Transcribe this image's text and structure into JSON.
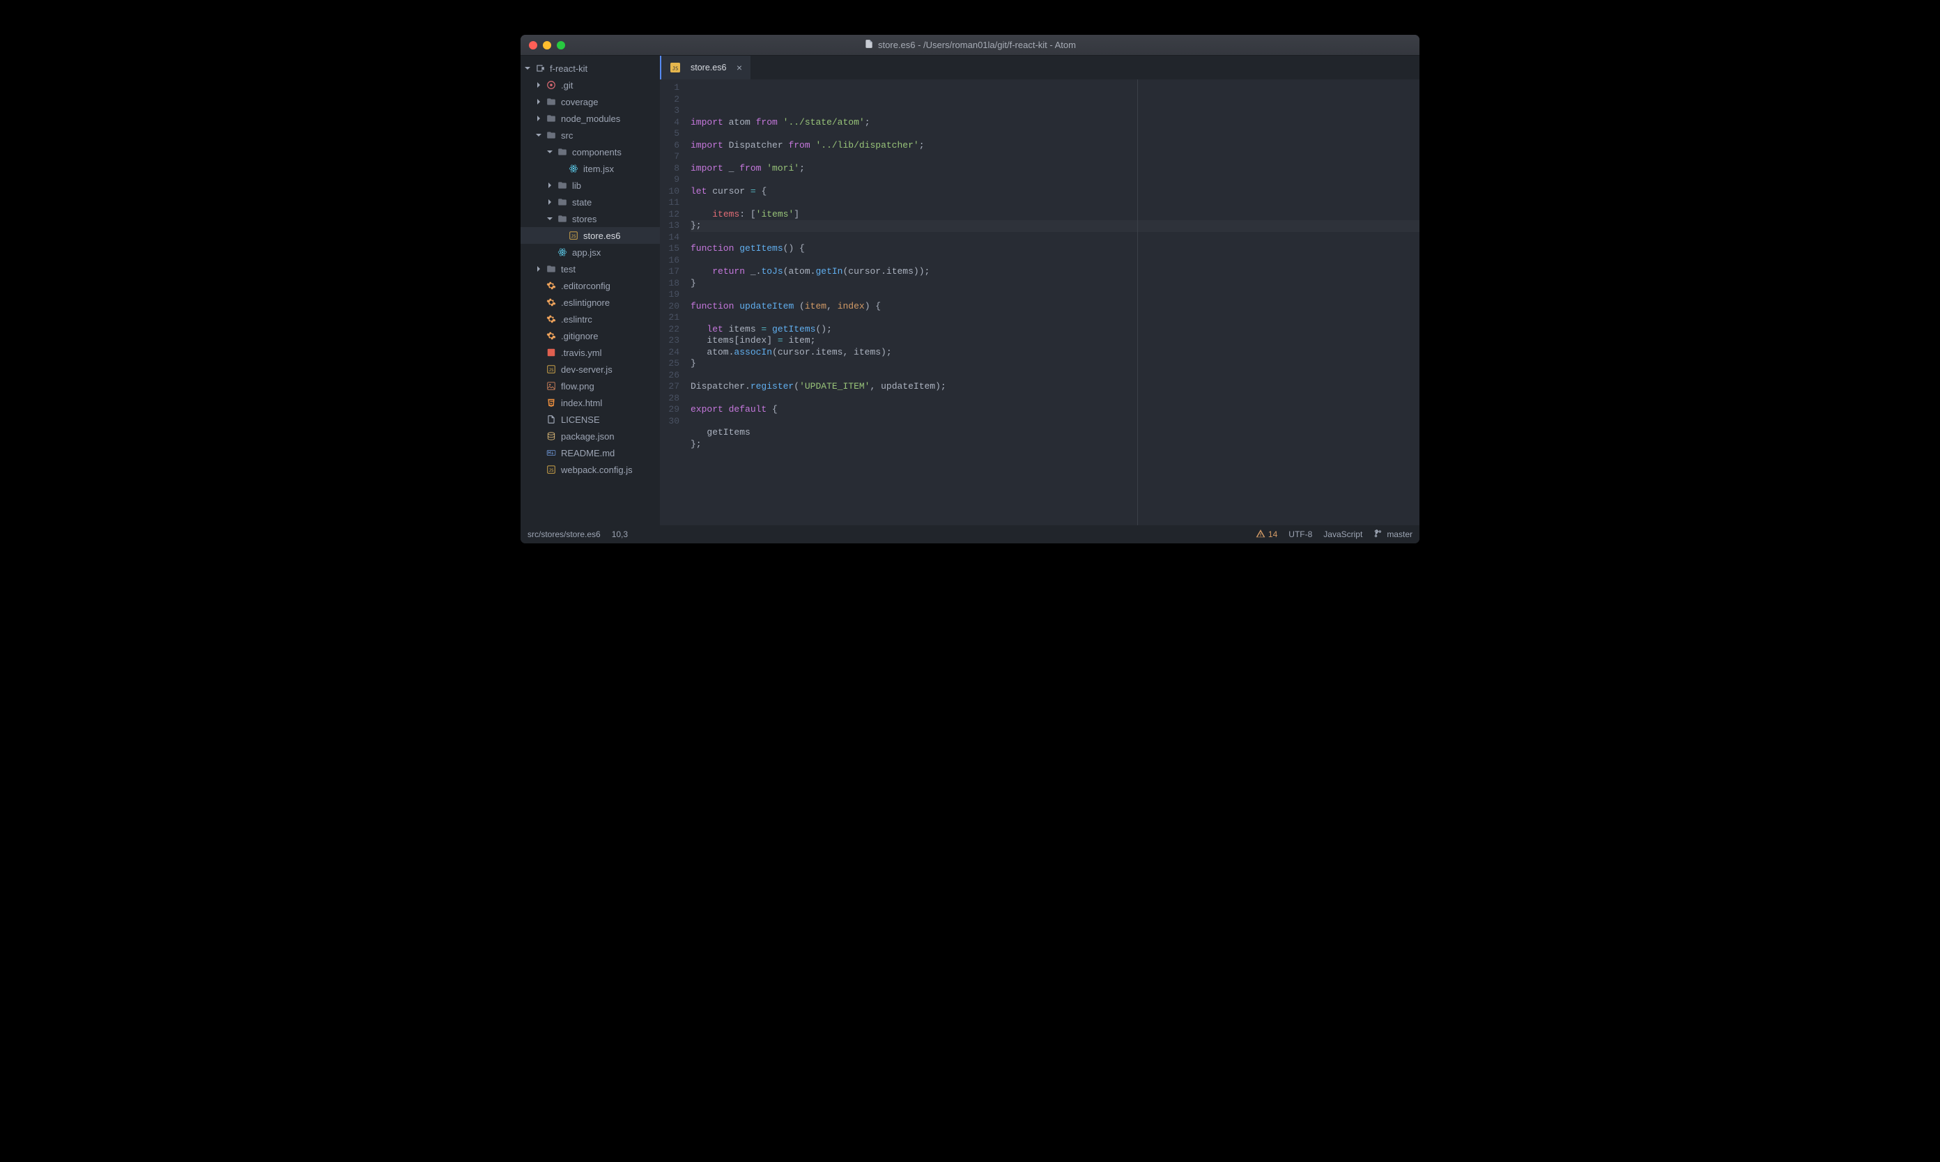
{
  "window": {
    "title": "store.es6 - /Users/roman01la/git/f-react-kit - Atom"
  },
  "sidebar": {
    "project": "f-react-kit",
    "items": [
      {
        "depth": 1,
        "icon": "git",
        "label": ".git",
        "chev": "closed"
      },
      {
        "depth": 1,
        "icon": "folder",
        "label": "coverage",
        "chev": "closed"
      },
      {
        "depth": 1,
        "icon": "folder",
        "label": "node_modules",
        "chev": "closed"
      },
      {
        "depth": 1,
        "icon": "folder",
        "label": "src",
        "chev": "open"
      },
      {
        "depth": 2,
        "icon": "folder",
        "label": "components",
        "chev": "open"
      },
      {
        "depth": 3,
        "icon": "react",
        "label": "item.jsx"
      },
      {
        "depth": 2,
        "icon": "folder",
        "label": "lib",
        "chev": "closed"
      },
      {
        "depth": 2,
        "icon": "folder",
        "label": "state",
        "chev": "closed"
      },
      {
        "depth": 2,
        "icon": "folder",
        "label": "stores",
        "chev": "open"
      },
      {
        "depth": 3,
        "icon": "js",
        "label": "store.es6",
        "selected": true
      },
      {
        "depth": 2,
        "icon": "react",
        "label": "app.jsx"
      },
      {
        "depth": 1,
        "icon": "folder",
        "label": "test",
        "chev": "closed"
      },
      {
        "depth": 1,
        "icon": "gear",
        "label": ".editorconfig"
      },
      {
        "depth": 1,
        "icon": "gear",
        "label": ".eslintignore"
      },
      {
        "depth": 1,
        "icon": "gear",
        "label": ".eslintrc"
      },
      {
        "depth": 1,
        "icon": "gear",
        "label": ".gitignore"
      },
      {
        "depth": 1,
        "icon": "yml",
        "label": ".travis.yml"
      },
      {
        "depth": 1,
        "icon": "js",
        "label": "dev-server.js"
      },
      {
        "depth": 1,
        "icon": "png",
        "label": "flow.png"
      },
      {
        "depth": 1,
        "icon": "html",
        "label": "index.html"
      },
      {
        "depth": 1,
        "icon": "txt",
        "label": "LICENSE"
      },
      {
        "depth": 1,
        "icon": "db",
        "label": "package.json"
      },
      {
        "depth": 1,
        "icon": "md",
        "label": "README.md"
      },
      {
        "depth": 1,
        "icon": "js",
        "label": "webpack.config.js"
      }
    ]
  },
  "tab": {
    "label": "store.es6"
  },
  "editor": {
    "line_count": 30,
    "highlighted_line": 10,
    "lines": [
      [
        [
          "kw",
          "import"
        ],
        [
          "def",
          " atom "
        ],
        [
          "kw",
          "from"
        ],
        [
          "pun",
          " "
        ],
        [
          "str",
          "'../state/atom'"
        ],
        [
          "pun",
          ";"
        ]
      ],
      [],
      [
        [
          "kw",
          "import"
        ],
        [
          "def",
          " Dispatcher "
        ],
        [
          "kw",
          "from"
        ],
        [
          "pun",
          " "
        ],
        [
          "str",
          "'../lib/dispatcher'"
        ],
        [
          "pun",
          ";"
        ]
      ],
      [],
      [
        [
          "kw",
          "import"
        ],
        [
          "def",
          " _ "
        ],
        [
          "kw",
          "from"
        ],
        [
          "pun",
          " "
        ],
        [
          "str",
          "'mori'"
        ],
        [
          "pun",
          ";"
        ]
      ],
      [],
      [
        [
          "kw",
          "let"
        ],
        [
          "def",
          " cursor "
        ],
        [
          "op",
          "="
        ],
        [
          "pun",
          " {"
        ]
      ],
      [],
      [
        [
          "pun",
          "    "
        ],
        [
          "prop",
          "items"
        ],
        [
          "pun",
          ": ["
        ],
        [
          "str",
          "'items'"
        ],
        [
          "pun",
          "]"
        ]
      ],
      [
        [
          "pun",
          "};"
        ]
      ],
      [],
      [
        [
          "kw",
          "function"
        ],
        [
          "pun",
          " "
        ],
        [
          "fn",
          "getItems"
        ],
        [
          "pun",
          "() {"
        ]
      ],
      [],
      [
        [
          "pun",
          "    "
        ],
        [
          "kw",
          "return"
        ],
        [
          "pun",
          " _."
        ],
        [
          "fn",
          "toJs"
        ],
        [
          "pun",
          "(atom."
        ],
        [
          "fn",
          "getIn"
        ],
        [
          "pun",
          "(cursor.items));"
        ]
      ],
      [
        [
          "pun",
          "}"
        ]
      ],
      [],
      [
        [
          "kw",
          "function"
        ],
        [
          "pun",
          " "
        ],
        [
          "fn",
          "updateItem"
        ],
        [
          "pun",
          " ("
        ],
        [
          "param",
          "item"
        ],
        [
          "pun",
          ", "
        ],
        [
          "param",
          "index"
        ],
        [
          "pun",
          ") {"
        ]
      ],
      [],
      [
        [
          "pun",
          "   "
        ],
        [
          "kw",
          "let"
        ],
        [
          "def",
          " items "
        ],
        [
          "op",
          "="
        ],
        [
          "pun",
          " "
        ],
        [
          "fn",
          "getItems"
        ],
        [
          "pun",
          "();"
        ]
      ],
      [
        [
          "pun",
          "   items[index] "
        ],
        [
          "op",
          "="
        ],
        [
          "pun",
          " item;"
        ]
      ],
      [
        [
          "pun",
          "   atom."
        ],
        [
          "fn",
          "assocIn"
        ],
        [
          "pun",
          "(cursor.items, items);"
        ]
      ],
      [
        [
          "pun",
          "}"
        ]
      ],
      [],
      [
        [
          "def",
          "Dispatcher."
        ],
        [
          "fn",
          "register"
        ],
        [
          "pun",
          "("
        ],
        [
          "str",
          "'UPDATE_ITEM'"
        ],
        [
          "pun",
          ", updateItem);"
        ]
      ],
      [],
      [
        [
          "kw",
          "export"
        ],
        [
          "pun",
          " "
        ],
        [
          "kw",
          "default"
        ],
        [
          "pun",
          " {"
        ]
      ],
      [],
      [
        [
          "pun",
          "   getItems"
        ]
      ],
      [
        [
          "pun",
          "};"
        ]
      ],
      []
    ]
  },
  "status": {
    "path": "src/stores/store.es6",
    "cursor": "10,3",
    "warnings": "14",
    "encoding": "UTF-8",
    "language": "JavaScript",
    "branch": "master"
  }
}
